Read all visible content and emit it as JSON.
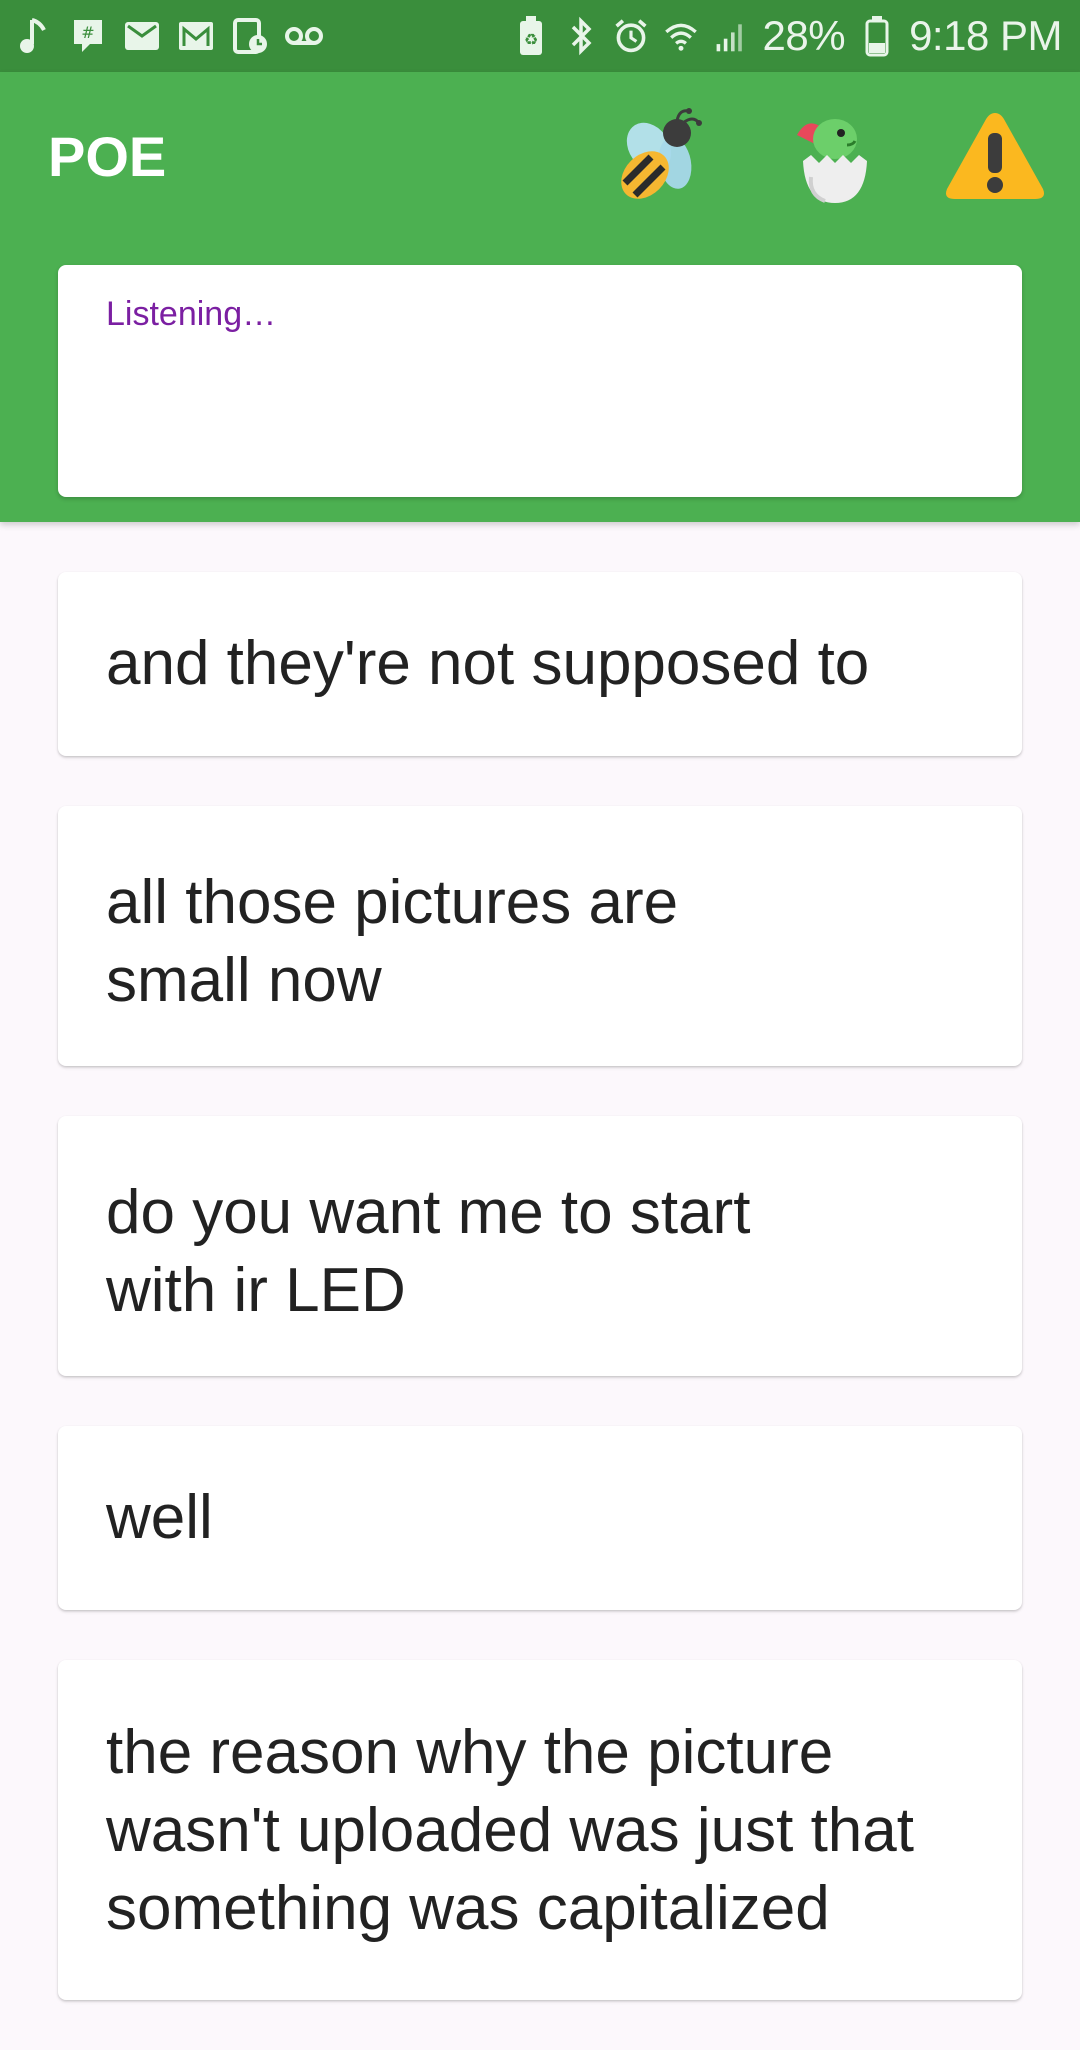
{
  "status_bar": {
    "battery_percent": "28%",
    "time": "9:18 PM",
    "left_icons": [
      "music-note-icon",
      "hangouts-icon",
      "email-icon",
      "gmail-icon",
      "calendar-icon",
      "voicemail-icon"
    ],
    "right_icons": [
      "battery-saver-icon",
      "bluetooth-icon",
      "alarm-icon",
      "wifi-icon",
      "signal-icon",
      "battery-icon"
    ],
    "background": "#3a8e3c"
  },
  "app_bar": {
    "title": "POE",
    "icons": [
      "bee-icon",
      "dinosaur-egg-icon",
      "warning-icon"
    ],
    "background": "#4cb051"
  },
  "listening": {
    "status": "Listening…",
    "color": "#7b1fa2"
  },
  "transcript": [
    {
      "text": "and they're not supposed to"
    },
    {
      "text": "all those pictures are small now"
    },
    {
      "text": "do you want me to start with ir LED"
    },
    {
      "text": "well"
    },
    {
      "text": "the reason why the picture wasn't uploaded was just that something was capitalized"
    }
  ]
}
